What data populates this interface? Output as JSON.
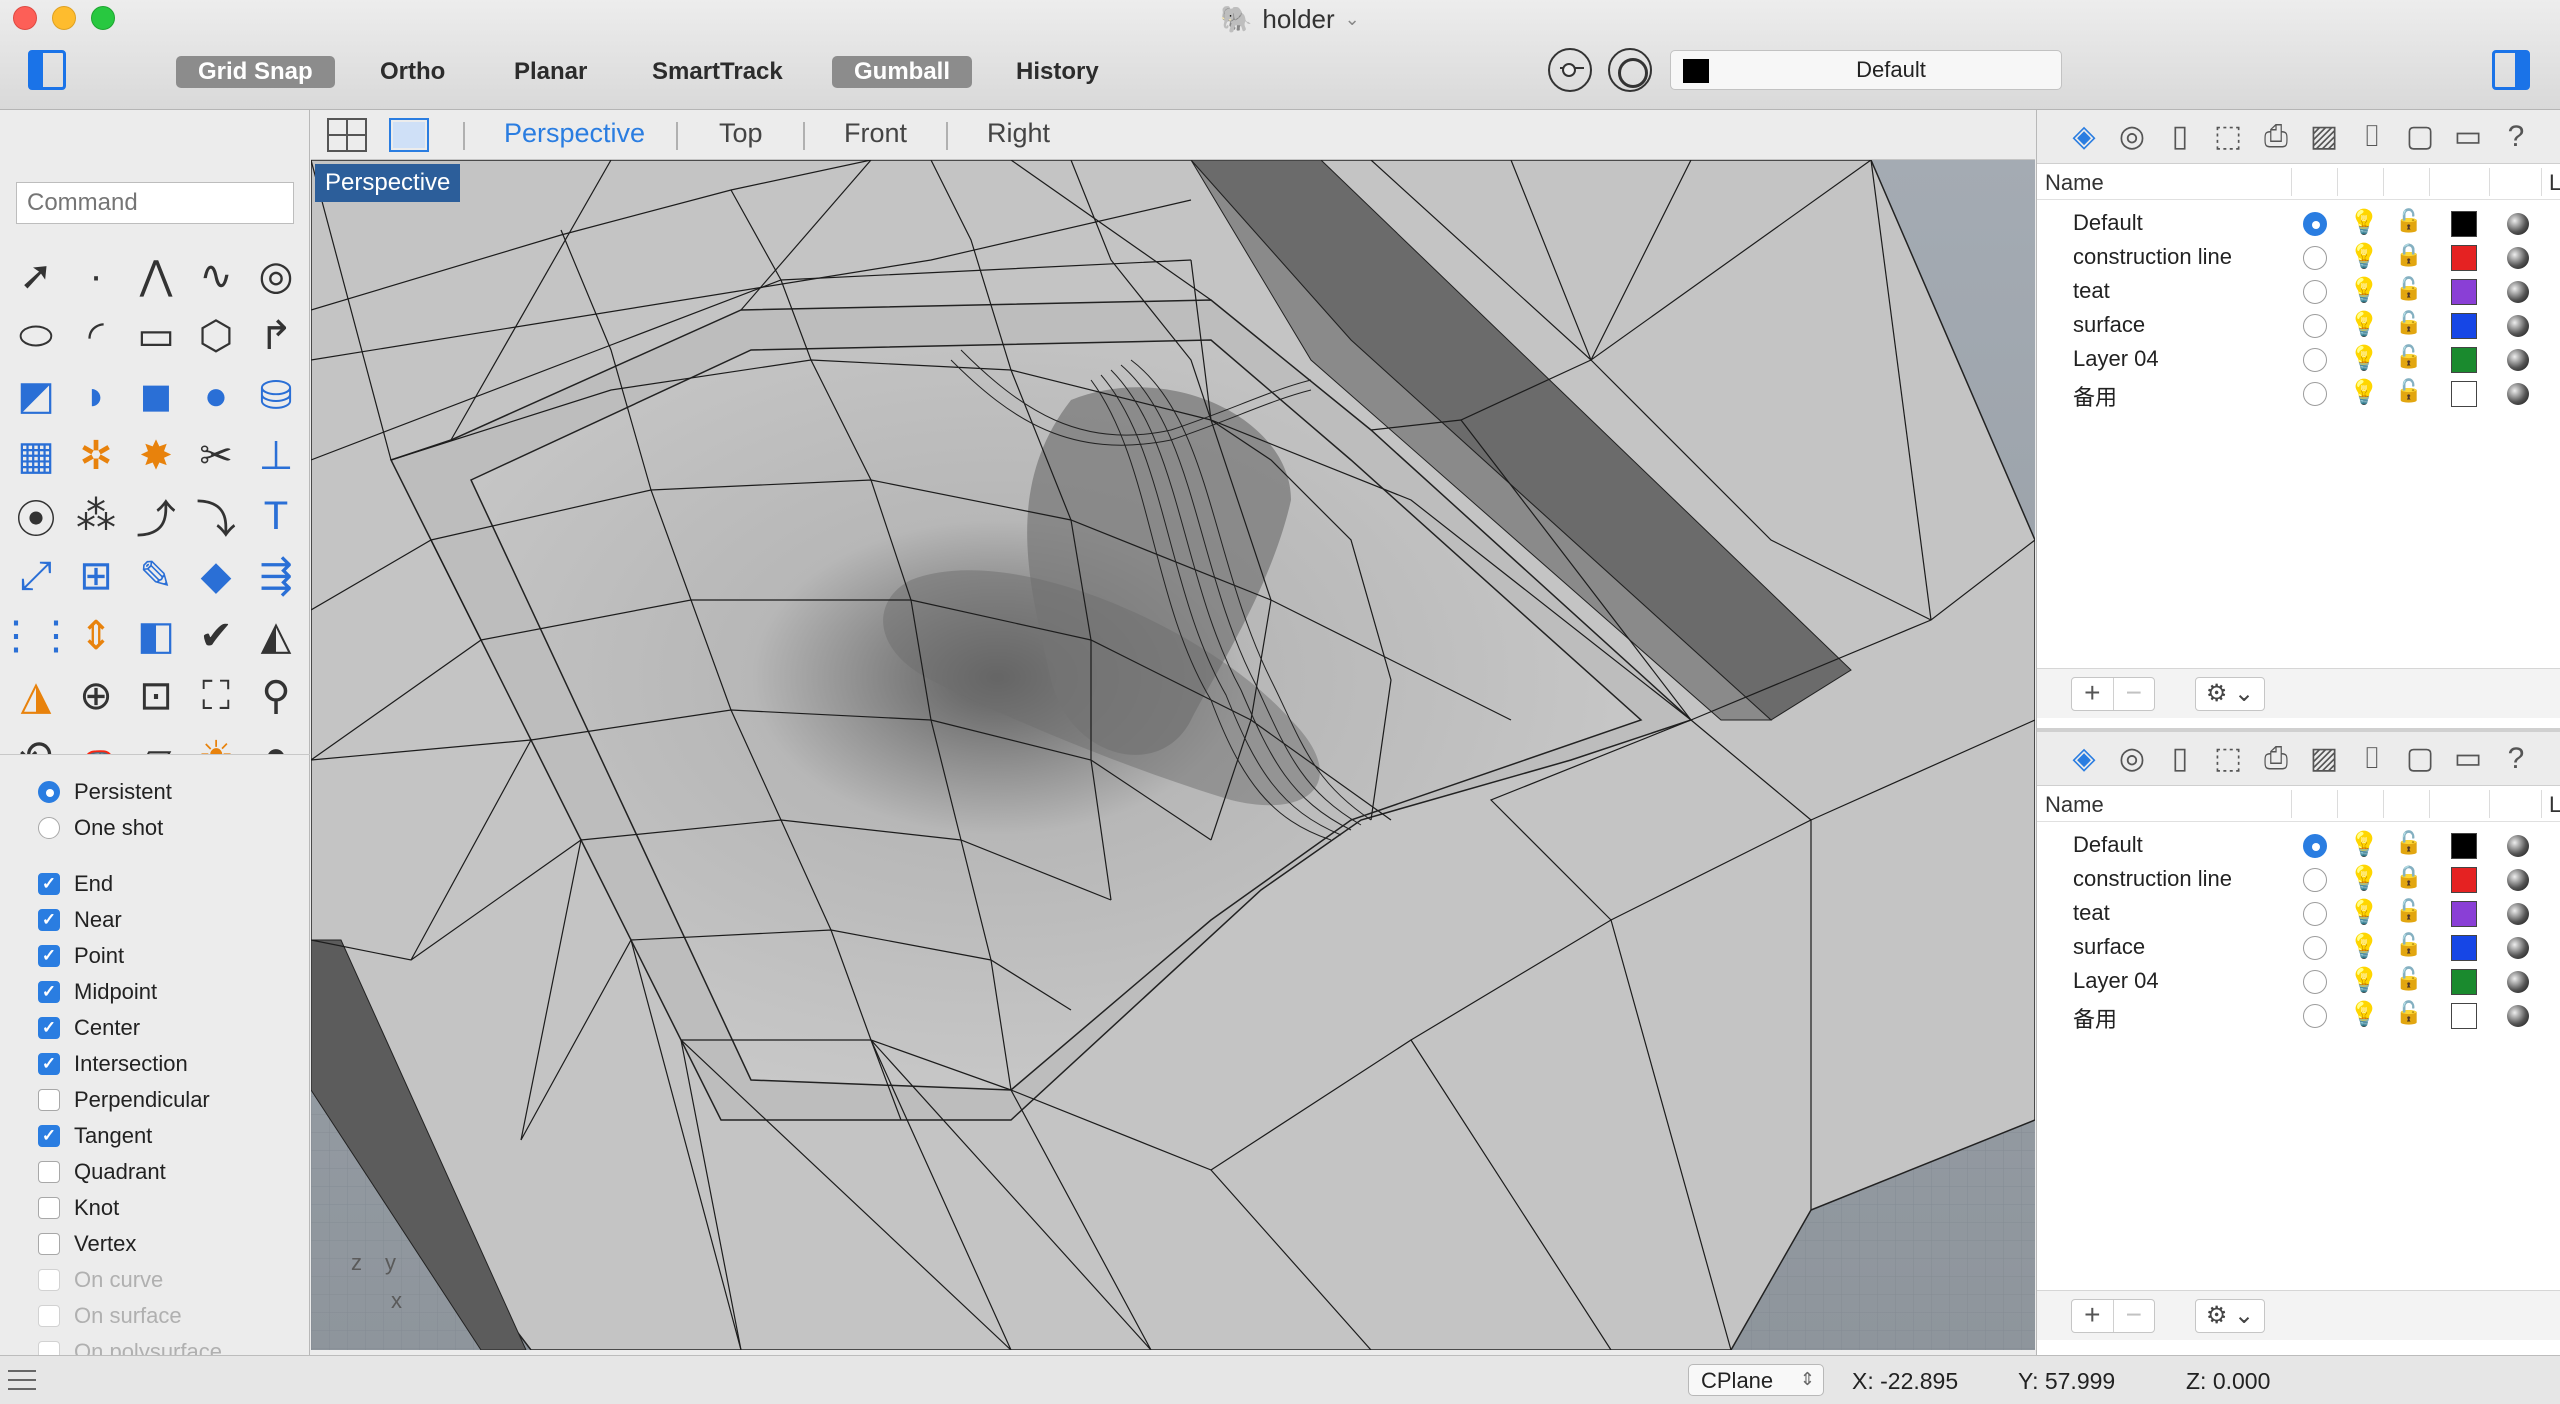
{
  "window": {
    "title": "holder"
  },
  "toolbar": {
    "modes": [
      {
        "label": "Grid Snap",
        "active": true
      },
      {
        "label": "Ortho",
        "active": false
      },
      {
        "label": "Planar",
        "active": false
      },
      {
        "label": "SmartTrack",
        "active": false
      },
      {
        "label": "Gumball",
        "active": true
      },
      {
        "label": "History",
        "active": false
      }
    ],
    "current_layer": "Default",
    "current_layer_color": "#000000"
  },
  "command": {
    "placeholder": "Command"
  },
  "snap_options": {
    "modes": [
      {
        "label": "Persistent",
        "selected": true
      },
      {
        "label": "One shot",
        "selected": false
      }
    ],
    "osnaps": [
      {
        "label": "End",
        "checked": true,
        "enabled": true
      },
      {
        "label": "Near",
        "checked": true,
        "enabled": true
      },
      {
        "label": "Point",
        "checked": true,
        "enabled": true
      },
      {
        "label": "Midpoint",
        "checked": true,
        "enabled": true
      },
      {
        "label": "Center",
        "checked": true,
        "enabled": true
      },
      {
        "label": "Intersection",
        "checked": true,
        "enabled": true
      },
      {
        "label": "Perpendicular",
        "checked": false,
        "enabled": true
      },
      {
        "label": "Tangent",
        "checked": true,
        "enabled": true
      },
      {
        "label": "Quadrant",
        "checked": false,
        "enabled": true
      },
      {
        "label": "Knot",
        "checked": false,
        "enabled": true
      },
      {
        "label": "Vertex",
        "checked": false,
        "enabled": true
      },
      {
        "label": "On curve",
        "checked": false,
        "enabled": false
      },
      {
        "label": "On surface",
        "checked": false,
        "enabled": false
      },
      {
        "label": "On polysurface",
        "checked": false,
        "enabled": false
      }
    ]
  },
  "viewports": {
    "tabs": [
      "Perspective",
      "Top",
      "Front",
      "Right"
    ],
    "active": "Perspective",
    "active_label": "Perspective",
    "axis_labels": {
      "z": "z",
      "y": "y",
      "x": "x"
    }
  },
  "layers_panel": {
    "column_header": "Name",
    "column_header_truncated": "L",
    "layers": [
      {
        "name": "Default",
        "current": true,
        "light_on": true,
        "locked": false,
        "color": "#000000"
      },
      {
        "name": "construction line",
        "current": false,
        "light_on": false,
        "locked": true,
        "color": "#e52222"
      },
      {
        "name": "teat",
        "current": false,
        "light_on": false,
        "locked": false,
        "color": "#8a3fd6"
      },
      {
        "name": "surface",
        "current": false,
        "light_on": false,
        "locked": false,
        "color": "#1646e6"
      },
      {
        "name": "Layer 04",
        "current": false,
        "light_on": true,
        "locked": false,
        "color": "#1a8a2e"
      },
      {
        "name": "备用",
        "current": false,
        "light_on": false,
        "locked": false,
        "color": "#ffffff"
      }
    ],
    "plus_label": "+",
    "minus_label": "−",
    "gear_label": "⚙ ⌄"
  },
  "statusbar": {
    "cplane": "CPlane",
    "x": "X: -22.895",
    "y": "Y: 57.999",
    "z": "Z: 0.000"
  }
}
